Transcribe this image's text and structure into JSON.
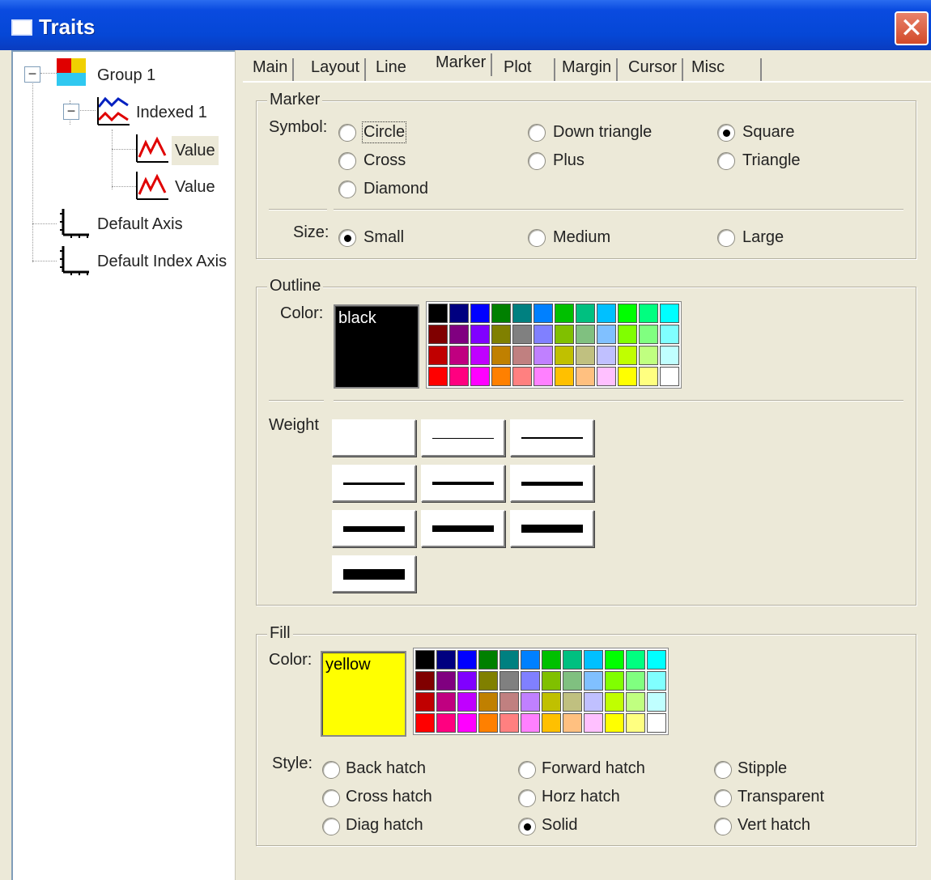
{
  "window": {
    "title": "Traits"
  },
  "tree": {
    "items": [
      {
        "label": "Group 1",
        "icon": "group-icon"
      },
      {
        "label": "Indexed 1",
        "icon": "indexed-icon"
      },
      {
        "label": "Value",
        "icon": "series-icon",
        "selected": true
      },
      {
        "label": "Value",
        "icon": "series-icon"
      },
      {
        "label": "Default Axis",
        "icon": "axis-icon"
      },
      {
        "label": "Default Index Axis",
        "icon": "axis-icon"
      }
    ]
  },
  "tabs": [
    "Main",
    "Layout",
    "Line",
    "Marker",
    "Plot",
    "Margin",
    "Cursor",
    "Misc"
  ],
  "active_tab": "Marker",
  "marker": {
    "group_title": "Marker",
    "symbol_label": "Symbol:",
    "symbols": [
      "Circle",
      "Down triangle",
      "Square",
      "Cross",
      "Plus",
      "Triangle",
      "Diamond"
    ],
    "selected_symbol": "Square",
    "size_label": "Size:",
    "sizes": [
      "Small",
      "Medium",
      "Large"
    ],
    "selected_size": "Small"
  },
  "outline": {
    "group_title": "Outline",
    "color_label": "Color:",
    "color_value": "black",
    "weight_label": "Weight"
  },
  "fill": {
    "group_title": "Fill",
    "color_label": "Color:",
    "color_value": "yellow",
    "style_label": "Style:",
    "styles": [
      "Back hatch",
      "Forward hatch",
      "Stipple",
      "Cross hatch",
      "Horz hatch",
      "Transparent",
      "Diag hatch",
      "Solid",
      "Vert hatch"
    ],
    "selected_style": "Solid"
  },
  "palette_colors": [
    "#000000",
    "#000080",
    "#0000ff",
    "#008000",
    "#008080",
    "#0080ff",
    "#00c000",
    "#00c080",
    "#00c0ff",
    "#00ff00",
    "#00ff80",
    "#00ffff",
    "#800000",
    "#800080",
    "#8000ff",
    "#808000",
    "#808080",
    "#8080ff",
    "#80c000",
    "#80c080",
    "#80c0ff",
    "#80ff00",
    "#80ff80",
    "#80ffff",
    "#c00000",
    "#c00080",
    "#c000ff",
    "#c08000",
    "#c08080",
    "#c080ff",
    "#c0c000",
    "#c0c080",
    "#c0c0ff",
    "#c0ff00",
    "#c0ff80",
    "#c0ffff",
    "#ff0000",
    "#ff0080",
    "#ff00ff",
    "#ff8000",
    "#ff8080",
    "#ff80ff",
    "#ffc000",
    "#ffc080",
    "#ffc0ff",
    "#ffff00",
    "#ffff80",
    "#ffffff"
  ],
  "weights": [
    0,
    1,
    2,
    3,
    4,
    5,
    7,
    8,
    10,
    13
  ],
  "colors": {
    "titlebar": "#0547d6",
    "outline_swatch": "#000000",
    "fill_swatch": "#ffff00",
    "close": "#d24a2a"
  }
}
